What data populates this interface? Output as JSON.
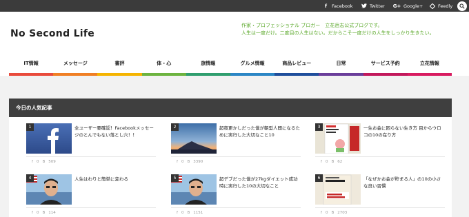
{
  "social": {
    "facebook": "Facebook",
    "twitter": "Twitter",
    "google_plus": "Google+",
    "feedly": "Feedly"
  },
  "site": {
    "title": "No Second Life",
    "tagline_line1": "作家・プロフェッショナル ブロガー　立花岳志公式ブログです。",
    "tagline_line2": "人生は一度だけ。二度目の人生はない。だからこそ一度だけの人生をしっかり生きたい。"
  },
  "nav": [
    {
      "label": "IT情報",
      "color": "#e94b3c"
    },
    {
      "label": "メッセージ",
      "color": "#f07f24"
    },
    {
      "label": "書評",
      "color": "#f5b400"
    },
    {
      "label": "体・心",
      "color": "#6cb33f"
    },
    {
      "label": "旅情報",
      "color": "#2f9e6e"
    },
    {
      "label": "グルメ情報",
      "color": "#2b86c5"
    },
    {
      "label": "商品レビュー",
      "color": "#1f4e9c"
    },
    {
      "label": "日常",
      "color": "#6a3d9a"
    },
    {
      "label": "サービス予約",
      "color": "#c2185b"
    },
    {
      "label": "立花情報",
      "color": "#d81b60"
    }
  ],
  "popular": {
    "heading": "今日の人気記事",
    "items": [
      {
        "rank": "1",
        "title": "全ユーザー要確認！Facebookメッセージのとんでもない落とし穴！！",
        "fb": "f",
        "count_a": "0",
        "count_b": "509",
        "thumb": "facebook"
      },
      {
        "rank": "2",
        "title": "超夜更かしだった僕が朝型人間になるために実行した大切なこと10",
        "fb": "f",
        "count_a": "0",
        "count_b": "3390",
        "thumb": "fuji"
      },
      {
        "rank": "3",
        "title": "一生お金に困らない生き方 目からウロコの10の在り方",
        "fb": "f",
        "count_a": "0",
        "count_b": "62",
        "thumb": "book1"
      },
      {
        "rank": "4",
        "title": "人生はわりと簡単に変わる",
        "fb": "f",
        "count_a": "0",
        "count_b": "114",
        "thumb": "person"
      },
      {
        "rank": "5",
        "title": "超デブだった僕が27kgダイエット成功時に実行した10の大切なこと",
        "fb": "f",
        "count_a": "0",
        "count_b": "1151",
        "thumb": "person"
      },
      {
        "rank": "6",
        "title": "「なぜかお金が貯まる人」の10の小さな良い習慣",
        "fb": "f",
        "count_a": "0",
        "count_b": "2703",
        "thumb": "book2"
      }
    ]
  },
  "colors": {
    "accent_green": "#5aa829",
    "dark_bar": "#3b3b3b",
    "panel_head": "#3f3f3f"
  }
}
